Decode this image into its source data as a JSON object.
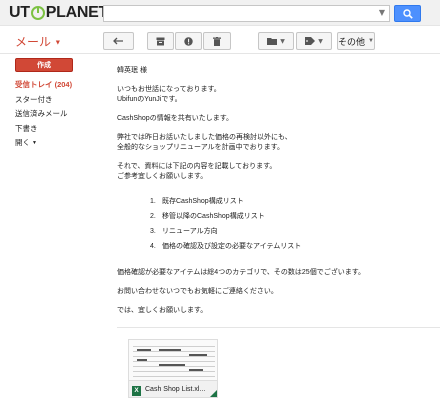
{
  "header": {
    "logo_prefix": "UT",
    "logo_suffix": "PLANET",
    "search_value": ""
  },
  "toolbar": {
    "mail_label": "メール",
    "more_label": "その他"
  },
  "sidebar": {
    "compose_label": "作成",
    "items": [
      {
        "label": "受信トレイ (204)"
      },
      {
        "label": "スター付き"
      },
      {
        "label": "送信済みメール"
      },
      {
        "label": "下書き"
      },
      {
        "label": "開く"
      }
    ]
  },
  "email": {
    "greeting": "韓英珉 様",
    "lines1": [
      "いつもお世話になっております。",
      "UbifunのYunJiです。"
    ],
    "line2": "CashShopの情報を共有いたします。",
    "lines3": [
      "弊社では昨日お話いたしました価格の再検討以外にも、",
      "全般的なショップリニューアルを計画中でおります。"
    ],
    "lines4": [
      "それで、資料には下記の内容を記載しております。",
      "ご参考宜しくお願いします。"
    ],
    "list": [
      {
        "num": "1.",
        "text": "既存CashShop構成リスト"
      },
      {
        "num": "2.",
        "text": "移管以降のCashShop構成リスト"
      },
      {
        "num": "3.",
        "text": "リニューアル方向"
      },
      {
        "num": "4.",
        "text": "価格の確認及び設定の必要なアイテムリスト"
      }
    ],
    "line5": "価格確認が必要なアイテムは総4つのカテゴリで、その数は25個でございます。",
    "line6": "お問い合わせないつでもお気軽にご連絡ください。",
    "line7": "では、宜しくお願いします。"
  },
  "attachment": {
    "icon_letter": "X",
    "name": "Cash Shop List.xl..."
  },
  "colors": {
    "accent": "#d14836",
    "search_button": "#4d90fe",
    "logo_ring": "#7cc242",
    "excel": "#1d7345"
  }
}
